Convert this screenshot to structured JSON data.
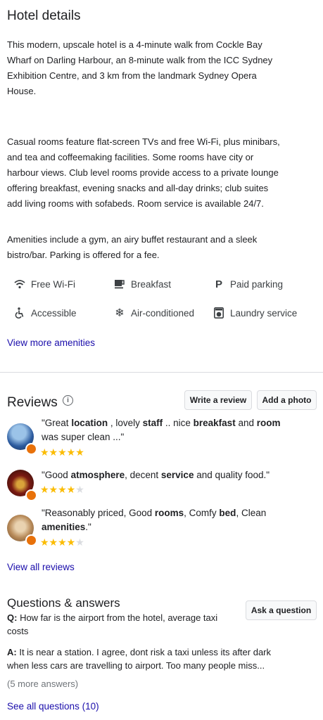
{
  "hotel": {
    "title": "Hotel details",
    "para1_lines": [
      "This modern, upscale hotel is a 4-minute walk from Cockle Bay",
      "Wharf on Darling Harbour, an 8-minute walk from the ICC Sydney",
      "Exhibition Centre, and 3 km from the landmark Sydney Opera",
      "House."
    ],
    "para2_lines": [
      "Casual rooms feature flat-screen TVs and free Wi-Fi, plus minibars,",
      "and tea and coffeemaking facilities. Some rooms have city or",
      "harbour views. Club level rooms provide access to a private lounge",
      "offering breakfast, evening snacks and all-day drinks; club suites",
      "add living rooms with sofabeds. Room service is available 24/7."
    ],
    "para3_lines": [
      "Amenities include a gym, an airy buffet restaurant and a sleek",
      "bistro/bar. Parking is offered for a fee."
    ],
    "amenities": [
      {
        "label": "Free Wi-Fi",
        "icon": "wifi-icon"
      },
      {
        "label": "Breakfast",
        "icon": "coffee-cup-icon"
      },
      {
        "label": "Paid parking",
        "icon": "parking-icon"
      },
      {
        "label": "Accessible",
        "icon": "accessible-icon"
      },
      {
        "label": "Air-conditioned",
        "icon": "snowflake-icon"
      },
      {
        "label": "Laundry service",
        "icon": "washing-machine-icon"
      }
    ],
    "more_amenities_link": "View more amenities"
  },
  "reviews": {
    "title": "Reviews",
    "write_review_label": "Write a review",
    "add_photo_label": "Add a photo",
    "items": [
      {
        "rating": 5,
        "avatar_colors": [
          "#2b5a9e",
          "#c44b2b"
        ]
      },
      {
        "rating": 4,
        "avatar_colors": [
          "#7a1a12",
          "#d9a33a"
        ]
      },
      {
        "rating": 4,
        "avatar_colors": [
          "#b88b5a",
          "#e9d2b0"
        ]
      }
    ],
    "quote1": {
      "p1": "\"Great ",
      "b1": "location",
      "p2": " , lovely ",
      "b2": "staff",
      "p3": " .. nice ",
      "b3": "breakfast",
      "p4": " and ",
      "b4": "room",
      "line2": "was super clean ...\""
    },
    "quote2": {
      "p1": "\"Good ",
      "b1": "atmosphere",
      "p2": ", decent ",
      "b2": "service",
      "p3": " and quality food.\""
    },
    "quote3": {
      "p1": "\"Reasonably priced, Good ",
      "b1": "rooms",
      "p2": ", Comfy ",
      "b2": "bed",
      "p3": ", Clean",
      "b3": "amenities",
      "p4": ".\""
    },
    "view_all_link": "View all reviews"
  },
  "qa": {
    "title": "Questions & answers",
    "ask_label": "Ask a question",
    "q_prefix": "Q:",
    "q_line1": " How far is the airport from the hotel, average taxi",
    "q_line2": "costs",
    "a_prefix": "A:",
    "a_line1": " It is near a station. I agree, dont risk a taxi unless its after dark",
    "a_line2": "when less cars are travelling to airport. Too many people miss...",
    "more_answers": "(5 more answers)",
    "see_all_link": "See all questions (10)"
  },
  "colors": {
    "link": "#1a0dab",
    "star": "#fbbc04",
    "badge": "#e8710a"
  }
}
